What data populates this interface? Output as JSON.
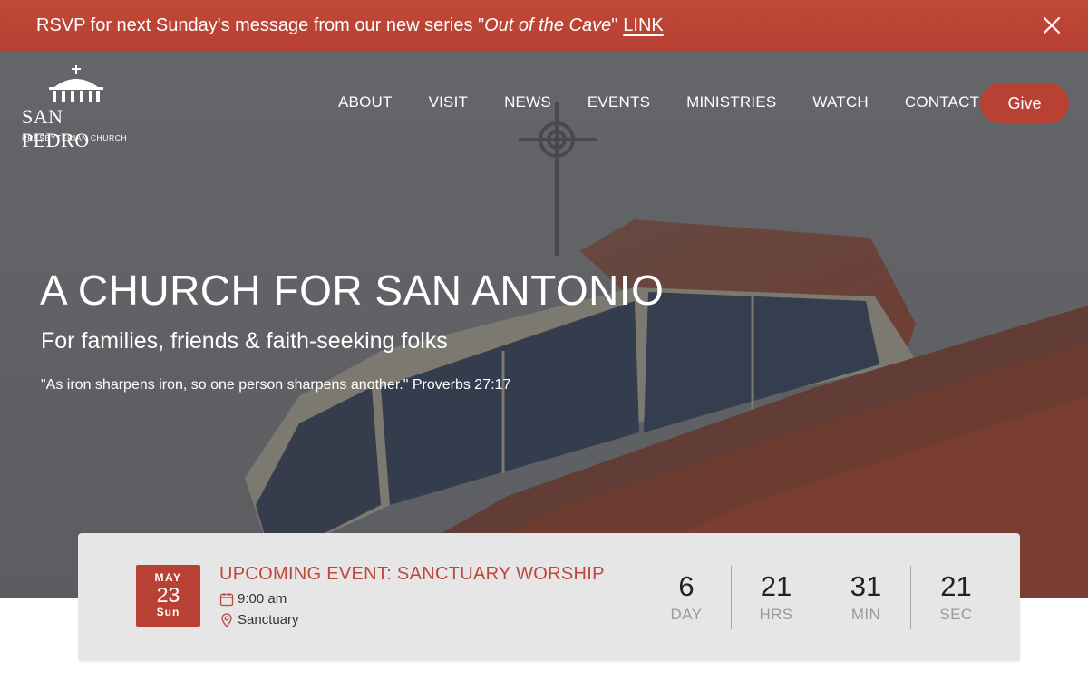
{
  "announcement": {
    "prefix": "RSVP for next Sunday's message from our new series \"",
    "series": "Out of the Cave",
    "suffix": "\"",
    "link_label": "LINK",
    "close_icon": "close-icon"
  },
  "logo": {
    "name": "SAN PEDRO",
    "subtitle": "PRESBYTERIAN CHURCH"
  },
  "nav": {
    "items": [
      {
        "label": "ABOUT"
      },
      {
        "label": "VISIT"
      },
      {
        "label": "NEWS"
      },
      {
        "label": "EVENTS"
      },
      {
        "label": "MINISTRIES"
      },
      {
        "label": "WATCH"
      },
      {
        "label": "CONTACT"
      }
    ],
    "give_label": "Give"
  },
  "hero": {
    "title": "A CHURCH FOR SAN ANTONIO",
    "subtitle": "For families, friends & faith-seeking folks",
    "quote": "\"As iron sharpens iron, so one person sharpens another.\" Proverbs 27:17"
  },
  "event": {
    "month": "MAY",
    "day": "23",
    "weekday": "Sun",
    "title": "UPCOMING EVENT: SANCTUARY WORSHIP",
    "time": "9:00 am",
    "location": "Sanctuary",
    "countdown": [
      {
        "value": "6",
        "label": "DAY"
      },
      {
        "value": "21",
        "label": "HRS"
      },
      {
        "value": "31",
        "label": "MIN"
      },
      {
        "value": "21",
        "label": "SEC"
      }
    ]
  },
  "colors": {
    "accent": "#b94133",
    "accent_text": "#c0453a",
    "card_bg": "#e6e6e6"
  }
}
